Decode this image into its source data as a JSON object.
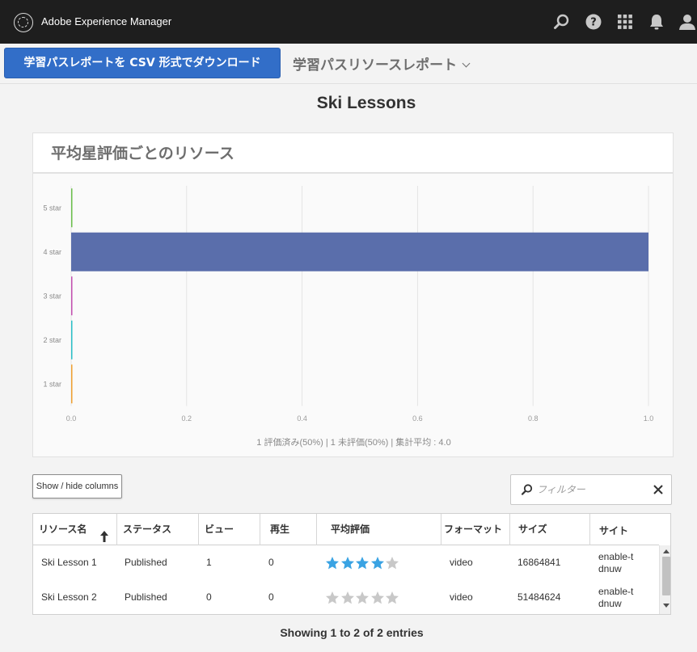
{
  "app": {
    "title": "Adobe Experience Manager"
  },
  "topbar": {
    "icons": [
      "search-icon",
      "help-icon",
      "apps-grid-icon",
      "bell-icon",
      "user-icon"
    ]
  },
  "toolbar": {
    "download_label": "学習パスレポートを CSV 形式でダウンロード",
    "report_selector_label": "学習パスリソースレポート"
  },
  "page": {
    "title": "Ski Lessons"
  },
  "chart_card": {
    "title": "平均星評価ごとのリソース",
    "summary": "1 評価済み(50%) | 1 未評価(50%) | 集計平均 : 4.0"
  },
  "chart_data": {
    "type": "bar",
    "orientation": "horizontal",
    "categories": [
      "5 star",
      "4 star",
      "3 star",
      "2 star",
      "1 star"
    ],
    "values": [
      0,
      1,
      0,
      0,
      0
    ],
    "colors": [
      "#6abf4b",
      "#5a6eab",
      "#c34fb0",
      "#2bbfc7",
      "#f0a030"
    ],
    "xlim": [
      0,
      1
    ],
    "xticks": [
      "0.0",
      "0.2",
      "0.4",
      "0.6",
      "0.8",
      "1.0"
    ],
    "grid": true
  },
  "controls": {
    "show_hide_columns_label": "Show / hide columns",
    "filter_placeholder": "フィルター"
  },
  "table": {
    "columns": [
      "リソース名",
      "ステータス",
      "ビュー",
      "再生",
      "平均評価",
      "フォーマット",
      "サイズ",
      "サイト"
    ],
    "sorted_column": "リソース名",
    "sort_direction": "ascending",
    "rows": [
      {
        "name": "Ski Lesson 1",
        "status": "Published",
        "views": "1",
        "plays": "0",
        "rating": 4,
        "format": "video",
        "size": "16864841",
        "site": "enable-tdnuw"
      },
      {
        "name": "Ski Lesson 2",
        "status": "Published",
        "views": "0",
        "plays": "0",
        "rating": 0,
        "format": "video",
        "size": "51484624",
        "site": "enable-tdnuw"
      }
    ],
    "rating_color": "#3aa3e3",
    "rating_empty_color": "#c8c8c8"
  },
  "footer": {
    "entries_text": "Showing 1 to 2 of 2 entries"
  }
}
